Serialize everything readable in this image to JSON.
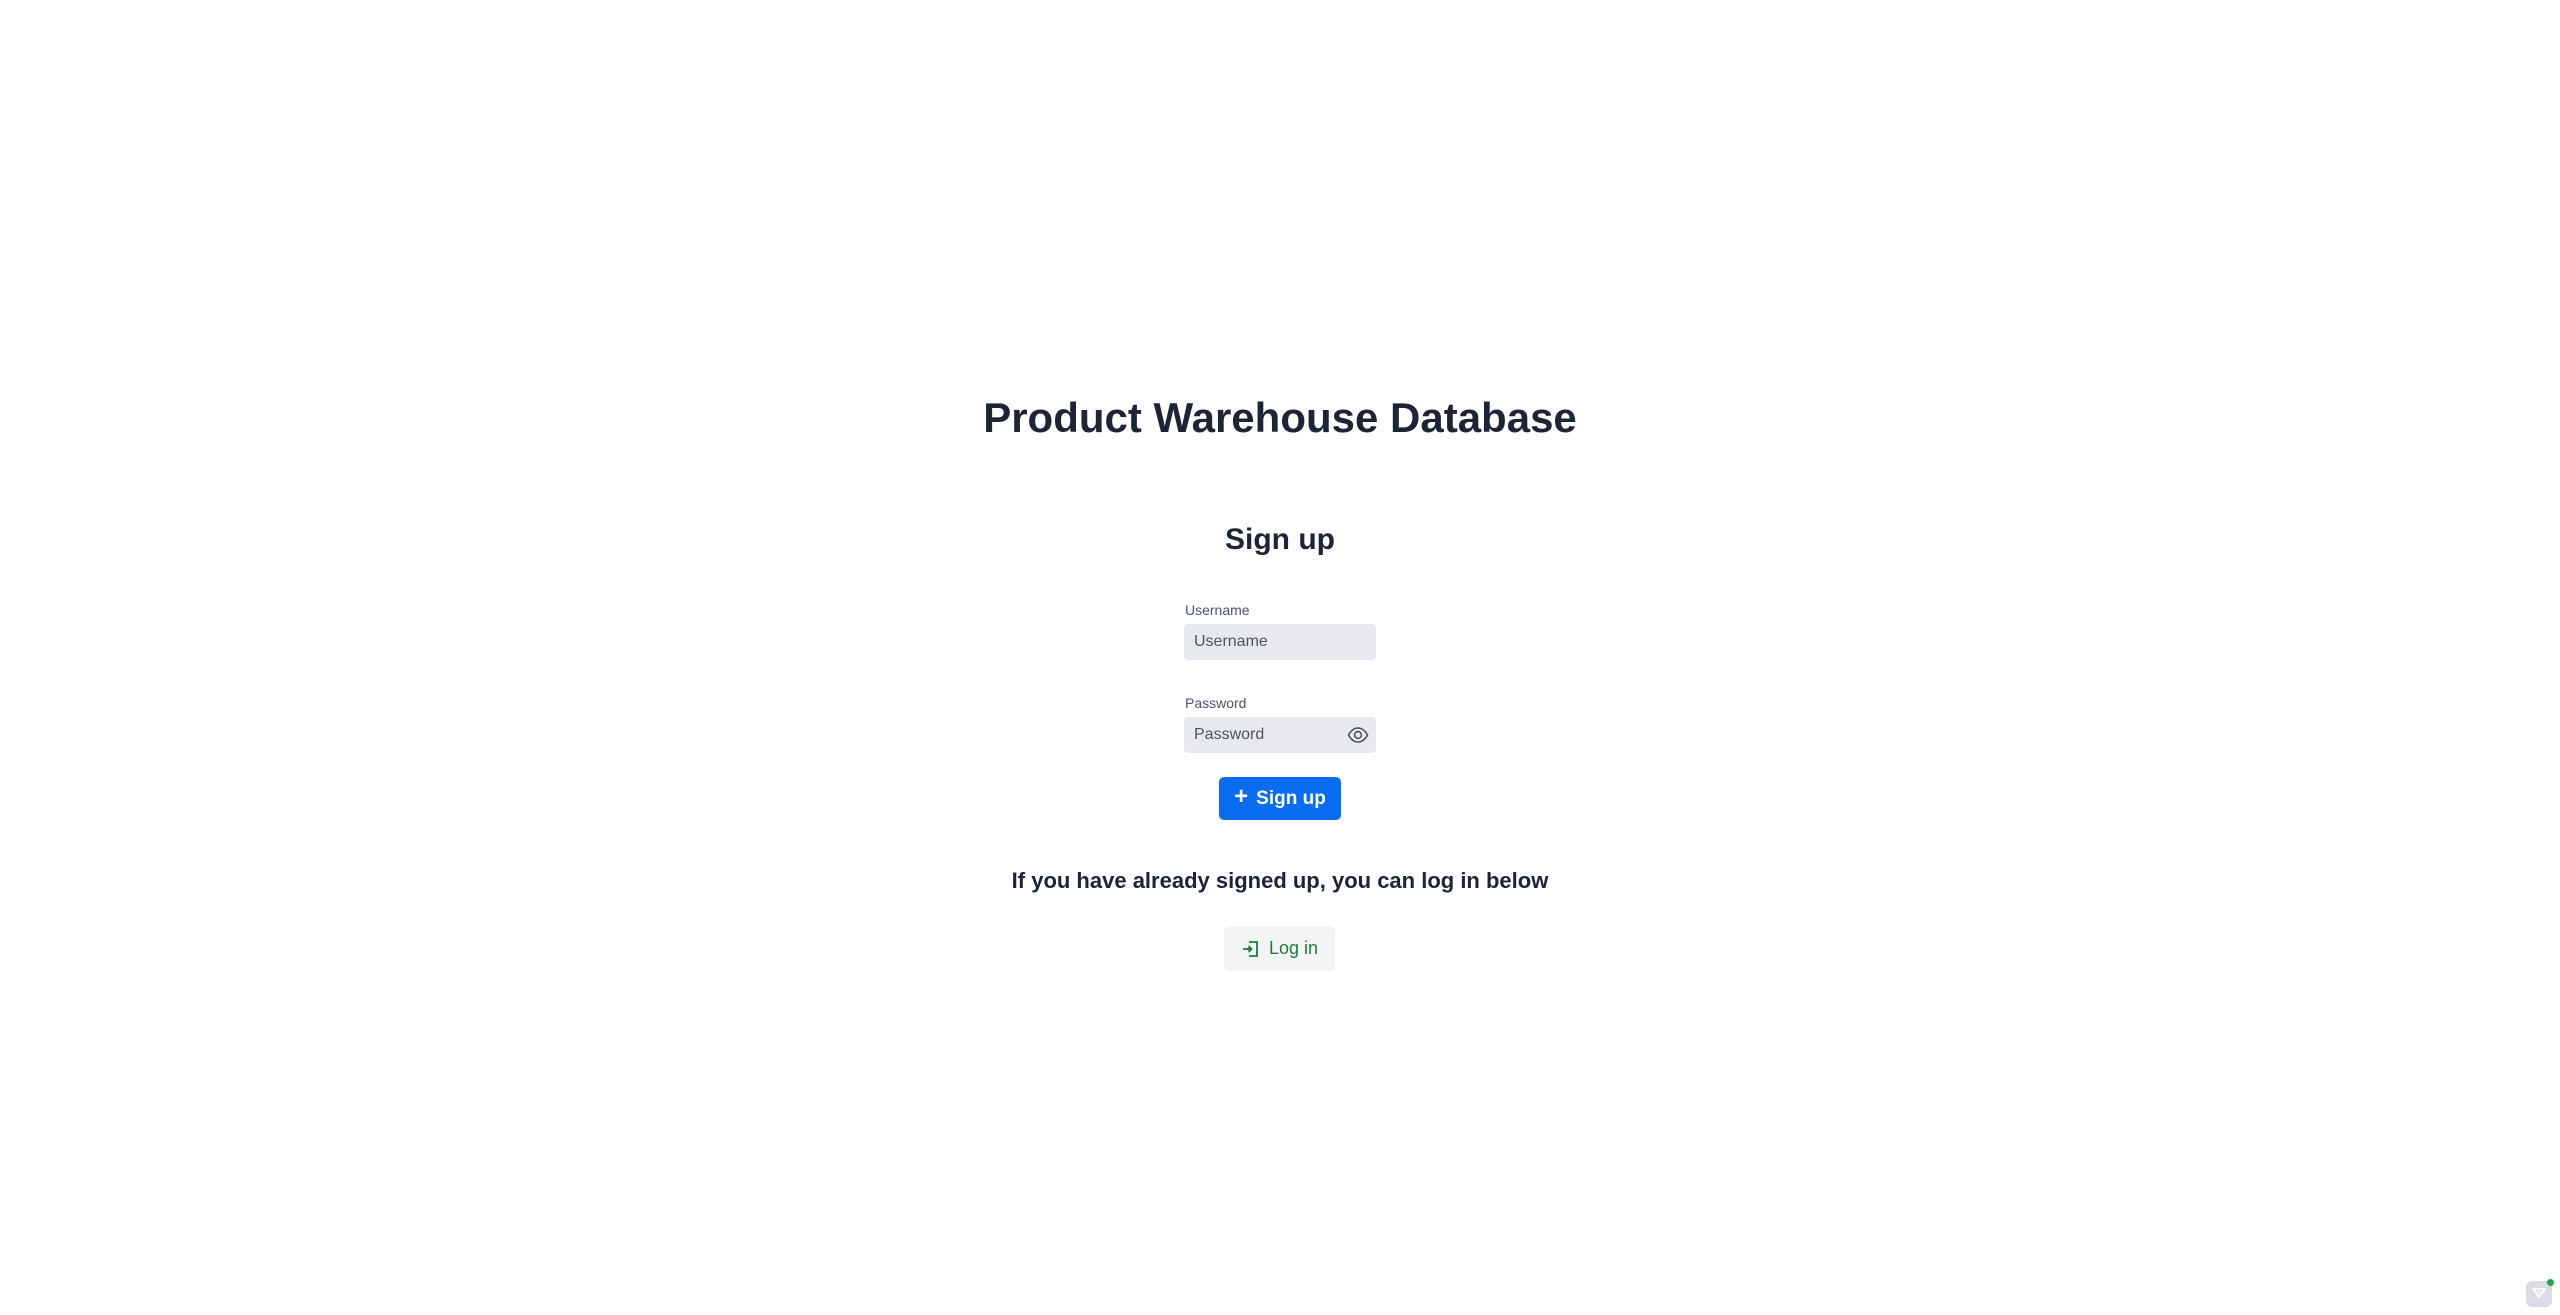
{
  "app": {
    "title": "Product Warehouse Database"
  },
  "signup_form": {
    "title": "Sign up",
    "username": {
      "label": "Username",
      "placeholder": "Username",
      "value": ""
    },
    "password": {
      "label": "Password",
      "placeholder": "Password",
      "value": ""
    },
    "submit_label": "Sign up",
    "submit_icon": "plus-icon"
  },
  "login_section": {
    "hint": "If you have already signed up, you can log in below",
    "button_label": "Log in",
    "button_icon": "login-icon"
  },
  "colors": {
    "primary": "#0a6cf0",
    "success": "#1a7f3c",
    "heading": "#1c2536",
    "field_bg": "#e7e9ee"
  },
  "widgets": {
    "corner_icon": "chat-widget-icon"
  }
}
